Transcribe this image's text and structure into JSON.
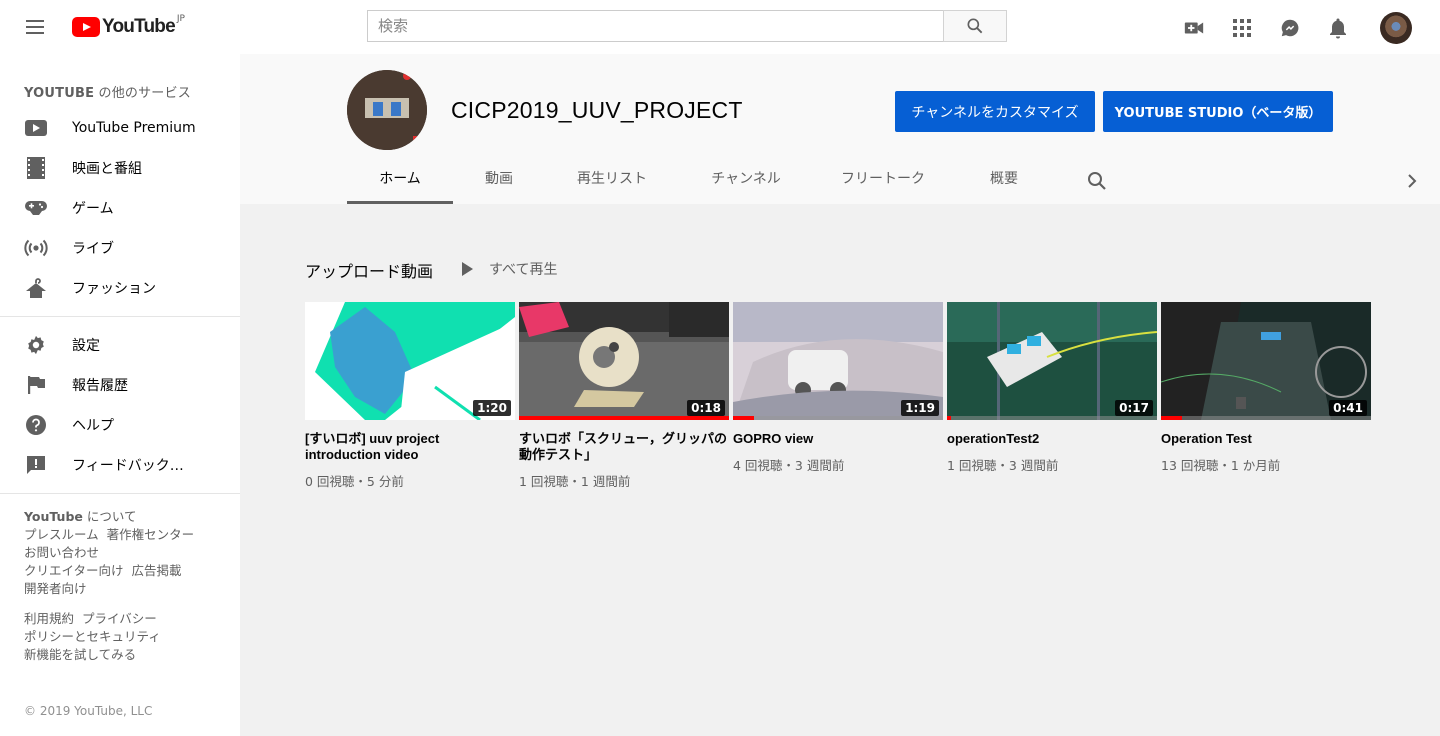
{
  "header": {
    "logo_text": "YouTube",
    "logo_region": "JP",
    "search_placeholder": "検索",
    "icons": [
      "menu-icon",
      "video-camera-plus-icon",
      "apps-grid-icon",
      "messages-icon",
      "notifications-bell-icon"
    ]
  },
  "sidebar": {
    "section_title_bold": "YOUTUBE",
    "section_title_rest": " の他のサービス",
    "services": [
      {
        "label": "YouTube Premium",
        "icon": "youtube-premium-icon"
      },
      {
        "label": "映画と番組",
        "icon": "film-icon"
      },
      {
        "label": "ゲーム",
        "icon": "gamepad-icon"
      },
      {
        "label": "ライブ",
        "icon": "live-icon"
      },
      {
        "label": "ファッション",
        "icon": "hanger-icon"
      }
    ],
    "settings": [
      {
        "label": "設定",
        "icon": "gear-icon"
      },
      {
        "label": "報告履歴",
        "icon": "flag-icon"
      },
      {
        "label": "ヘルプ",
        "icon": "help-icon"
      },
      {
        "label": "フィードバック…",
        "icon": "feedback-icon"
      }
    ],
    "footer_about_bold": "YouTube",
    "footer_about_rest": " について",
    "footer_links_1": [
      "プレスルーム",
      "著作権センター",
      "お問い合わせ",
      "クリエイター向け",
      "広告掲載",
      "開発者向け"
    ],
    "footer_links_2": [
      "利用規約",
      "プライバシー",
      "ポリシーとセキュリティ",
      "新機能を試してみる"
    ],
    "copyright": "© 2019 YouTube, LLC"
  },
  "channel": {
    "name": "CICP2019_UUV_PROJECT",
    "customize_button": "チャンネルをカスタマイズ",
    "studio_button": "YOUTUBE STUDIO（ベータ版）",
    "tabs": [
      "ホーム",
      "動画",
      "再生リスト",
      "チャンネル",
      "フリートーク",
      "概要"
    ],
    "active_tab": "ホーム"
  },
  "shelf": {
    "title": "アップロード動画",
    "play_all": "すべて再生",
    "videos": [
      {
        "title": "[すいロボ] uuv project introduction video",
        "duration": "1:20",
        "meta": "0 回視聴・5 分前",
        "progress": 0
      },
      {
        "title": "すいロボ「スクリュー，グリッパの動作テスト」",
        "duration": "0:18",
        "meta": "1 回視聴・1 週間前",
        "progress": 1.0
      },
      {
        "title": "GOPRO view",
        "duration": "1:19",
        "meta": "4 回視聴・3 週間前",
        "progress": 0.1
      },
      {
        "title": "operationTest2",
        "duration": "0:17",
        "meta": "1 回視聴・3 週間前",
        "progress": 0.02
      },
      {
        "title": "Operation Test",
        "duration": "0:41",
        "meta": "13 回視聴・1 か月前",
        "progress": 0.1
      }
    ]
  },
  "colors": {
    "brand_red": "#ff0000",
    "button_blue": "#065fd4"
  }
}
